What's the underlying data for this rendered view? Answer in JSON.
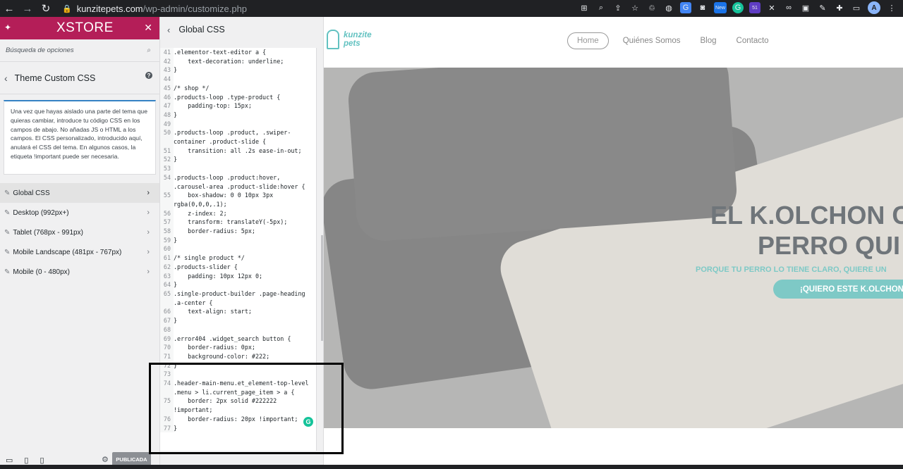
{
  "browser": {
    "url_host": "kunzitepets.com",
    "url_path": "/wp-admin/customize.php",
    "avatar_letter": "A",
    "ext_badges": [
      "New",
      "51"
    ]
  },
  "customizer": {
    "brand": "XSTORE",
    "search_placeholder": "Búsqueda de opciones",
    "section_title": "Theme Custom CSS",
    "description": "Una vez que hayas aislado una parte del tema que quieras cambiar, introduce tu código CSS en los campos de abajo. No añadas JS o HTML a los campos. El CSS personalizado, introducido aquí, anulará el CSS del tema. En algunos casos, la etiqueta !important puede ser necesaria.",
    "items": [
      {
        "label": "Global CSS"
      },
      {
        "label": "Desktop (992px+)"
      },
      {
        "label": "Tablet (768px - 991px)"
      },
      {
        "label": "Mobile Landscape (481px - 767px)"
      },
      {
        "label": "Mobile (0 - 480px)"
      }
    ],
    "publish_label": "PUBLICADA"
  },
  "editor": {
    "title": "Global CSS",
    "lines": [
      {
        "n": "41",
        "t": ".elementor-text-editor a {"
      },
      {
        "n": "42",
        "t": "    text-decoration: underline;"
      },
      {
        "n": "43",
        "t": "}"
      },
      {
        "n": "44",
        "t": ""
      },
      {
        "n": "45",
        "t": "/* shop */"
      },
      {
        "n": "46",
        "t": ".products-loop .type-product {"
      },
      {
        "n": "47",
        "t": "    padding-top: 15px;"
      },
      {
        "n": "48",
        "t": "}"
      },
      {
        "n": "49",
        "t": ""
      },
      {
        "n": "50",
        "t": ".products-loop .product, .swiper-"
      },
      {
        "n": "",
        "t": "container .product-slide {"
      },
      {
        "n": "51",
        "t": "    transition: all .2s ease-in-out;"
      },
      {
        "n": "52",
        "t": "}"
      },
      {
        "n": "53",
        "t": ""
      },
      {
        "n": "54",
        "t": ".products-loop .product:hover,"
      },
      {
        "n": "",
        "t": ".carousel-area .product-slide:hover {"
      },
      {
        "n": "55",
        "t": "    box-shadow: 0 0 10px 3px"
      },
      {
        "n": "",
        "t": "rgba(0,0,0,.1);"
      },
      {
        "n": "56",
        "t": "    z-index: 2;"
      },
      {
        "n": "57",
        "t": "    transform: translateY(-5px);"
      },
      {
        "n": "58",
        "t": "    border-radius: 5px;"
      },
      {
        "n": "59",
        "t": "}"
      },
      {
        "n": "60",
        "t": ""
      },
      {
        "n": "61",
        "t": "/* single product */"
      },
      {
        "n": "62",
        "t": ".products-slider {"
      },
      {
        "n": "63",
        "t": "    padding: 10px 12px 0;"
      },
      {
        "n": "64",
        "t": "}"
      },
      {
        "n": "65",
        "t": ".single-product-builder .page-heading"
      },
      {
        "n": "",
        "t": ".a-center {"
      },
      {
        "n": "66",
        "t": "    text-align: start;"
      },
      {
        "n": "67",
        "t": "}"
      },
      {
        "n": "68",
        "t": ""
      },
      {
        "n": "69",
        "t": ".error404 .widget_search button {"
      },
      {
        "n": "70",
        "t": "    border-radius: 0px;"
      },
      {
        "n": "71",
        "t": "    background-color: #222;"
      },
      {
        "n": "72",
        "t": "}"
      },
      {
        "n": "73",
        "t": ""
      },
      {
        "n": "74",
        "t": ".header-main-menu.et_element-top-level"
      },
      {
        "n": "",
        "t": ".menu > li.current_page_item > a {"
      },
      {
        "n": "75",
        "t": "    border: 2px solid #222222"
      },
      {
        "n": "",
        "t": "!important;"
      },
      {
        "n": "76",
        "t": "    border-radius: 20px !important;"
      },
      {
        "n": "77",
        "t": "}"
      }
    ]
  },
  "site": {
    "logo_line1": "kunzite",
    "logo_line2": "pets",
    "nav": [
      "Home",
      "Quiénes Somos",
      "Blog",
      "Contacto"
    ],
    "hero_title_1": "EL K.OLCHON C",
    "hero_title_2": "PERRO QUI",
    "hero_subtitle": "PORQUE TU PERRO LO TIENE CLARO, QUIERE UN",
    "hero_button": "¡QUIERO ESTE K.OLCHON"
  },
  "colors": {
    "xstore_brand": "#b41e58",
    "accent_teal": "#7ec9c6",
    "highlight_box": "#000000"
  }
}
